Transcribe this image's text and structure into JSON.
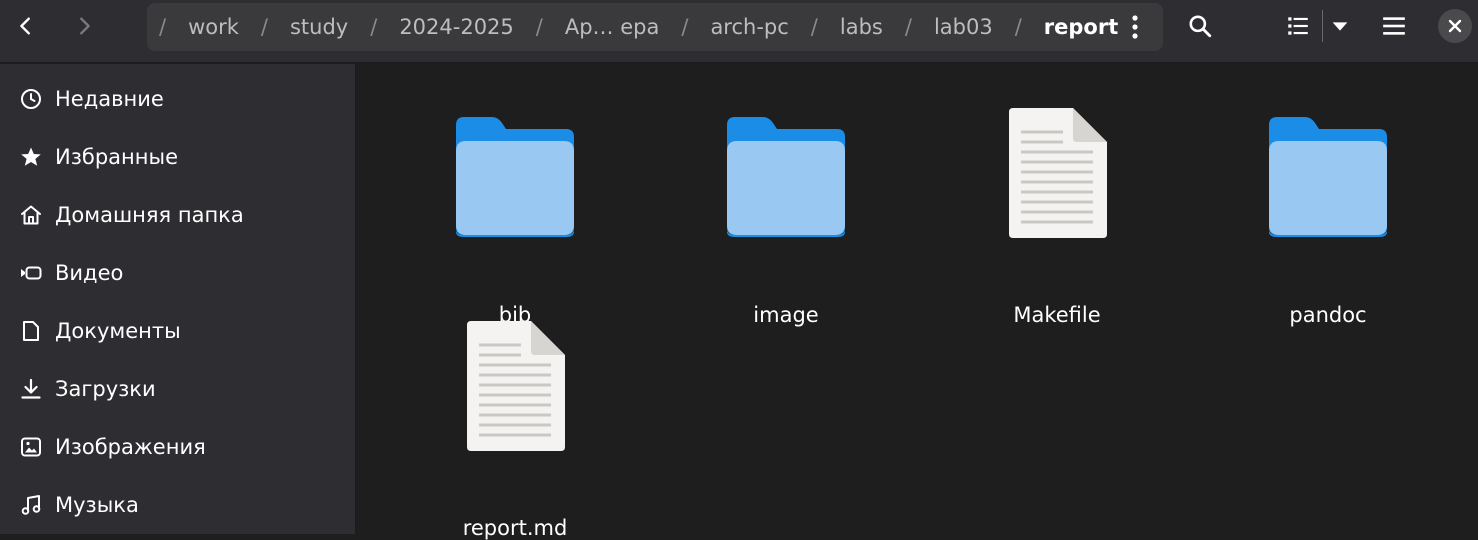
{
  "header": {
    "back_icon": "chevron-left-icon",
    "forward_icon": "chevron-right-icon",
    "path": {
      "segments": [
        "work",
        "study",
        "2024-2025",
        "Ар… ера",
        "arch-pc",
        "labs",
        "lab03",
        "report"
      ],
      "separator": "/"
    },
    "path_menu_icon": "vertical-dots-icon",
    "search_icon": "search-icon",
    "view_list_icon": "list-view-icon",
    "view_dropdown_icon": "caret-down-icon",
    "main_menu_icon": "hamburger-menu-icon",
    "close_icon": "close-icon"
  },
  "sidebar": {
    "items": [
      {
        "label": "Недавние",
        "icon": "clock-icon"
      },
      {
        "label": "Избранные",
        "icon": "star-icon"
      },
      {
        "label": "Домашняя папка",
        "icon": "home-icon"
      },
      {
        "label": "Видео",
        "icon": "video-icon"
      },
      {
        "label": "Документы",
        "icon": "document-icon"
      },
      {
        "label": "Загрузки",
        "icon": "download-icon"
      },
      {
        "label": "Изображения",
        "icon": "image-icon"
      },
      {
        "label": "Музыка",
        "icon": "music-icon"
      }
    ]
  },
  "files": [
    {
      "name": "bib",
      "type": "folder"
    },
    {
      "name": "image",
      "type": "folder"
    },
    {
      "name": "Makefile",
      "type": "text-file"
    },
    {
      "name": "pandoc",
      "type": "folder"
    },
    {
      "name": "report.md",
      "type": "text-file"
    }
  ],
  "colors": {
    "folder_back": "#1c8de6",
    "folder_front": "#99c8f2",
    "file_body": "#f4f3f1",
    "accent_header": "#2e2e32"
  }
}
